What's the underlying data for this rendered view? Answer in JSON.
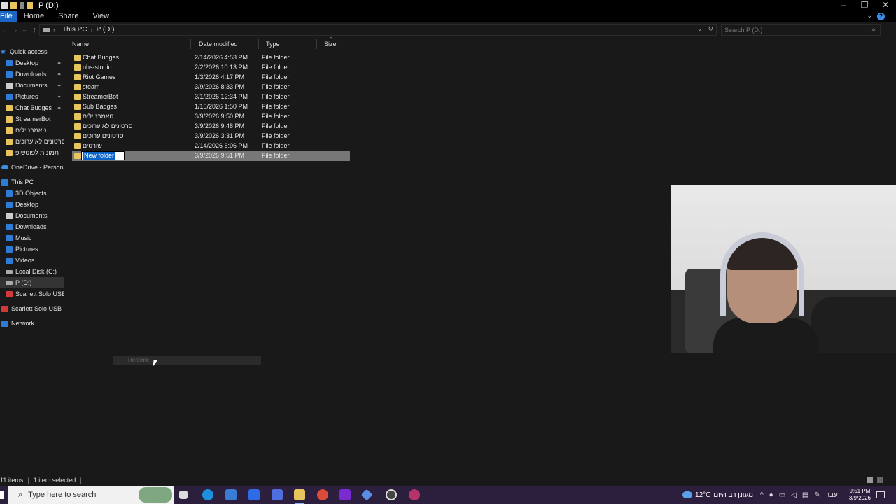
{
  "window": {
    "title": "P (D:)",
    "controls": [
      "–",
      "❐",
      "✕"
    ]
  },
  "ribbon": {
    "tabs": [
      "File",
      "Home",
      "Share",
      "View"
    ]
  },
  "address": {
    "crumbs": [
      "This PC",
      "P (D:)"
    ],
    "search_placeholder": "Search P (D:)"
  },
  "sidebar": {
    "quick_access": "Quick access",
    "pinned": [
      "Desktop",
      "Downloads",
      "Documents",
      "Pictures",
      "Chat Budges"
    ],
    "recent": [
      "StreamerBot",
      "טאמבניילים",
      "סרטונים לא ערוכים",
      "תמונות לפוטשופ"
    ],
    "onedrive": "OneDrive - Personal",
    "this_pc": "This PC",
    "pc_items": [
      "3D Objects",
      "Desktop",
      "Documents",
      "Downloads",
      "Music",
      "Pictures",
      "Videos",
      "Local Disk (C:)",
      "P (D:)",
      "Scarlett Solo USB (E",
      "Scarlett Solo USB (E:)"
    ],
    "network": "Network"
  },
  "columns": {
    "name": "Name",
    "date": "Date modified",
    "type": "Type",
    "size": "Size"
  },
  "files": [
    {
      "name": "Chat Budges",
      "date": "2/14/2026 4:53 PM",
      "type": "File folder"
    },
    {
      "name": "obs-studio",
      "date": "2/2/2026 10:13 PM",
      "type": "File folder"
    },
    {
      "name": "Riot Games",
      "date": "1/3/2026 4:17 PM",
      "type": "File folder"
    },
    {
      "name": "steam",
      "date": "3/9/2026 8:33 PM",
      "type": "File folder"
    },
    {
      "name": "StreamerBot",
      "date": "3/1/2026 12:34 PM",
      "type": "File folder"
    },
    {
      "name": "Sub Badges",
      "date": "1/10/2026 1:50 PM",
      "type": "File folder"
    },
    {
      "name": "טאמבניילים",
      "date": "3/9/2026 9:50 PM",
      "type": "File folder"
    },
    {
      "name": "סרטונים לא ערוכים",
      "date": "3/9/2026 9:48 PM",
      "type": "File folder"
    },
    {
      "name": "סרטונים ערוכים",
      "date": "3/9/2026 3:31 PM",
      "type": "File folder"
    },
    {
      "name": "שורטים",
      "date": "2/14/2026 6:06 PM",
      "type": "File folder"
    },
    {
      "name": "New folder",
      "date": "3/9/2026 9:51 PM",
      "type": "File folder"
    }
  ],
  "rename_tooltip": "Rename",
  "status": {
    "items": "11 items",
    "selected": "1 item selected"
  },
  "taskbar": {
    "search_text": "Type here to search",
    "weather_temp": "12°C",
    "weather_text": "מעונן רב היום",
    "lang": "עבר",
    "time": "9:51 PM",
    "date": "3/9/2026"
  }
}
